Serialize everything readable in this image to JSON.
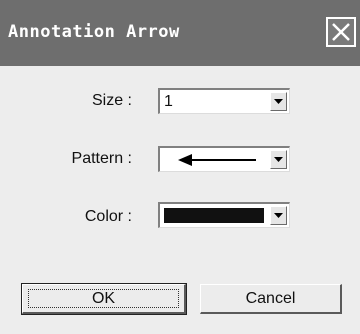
{
  "dialog": {
    "title": "Annotation Arrow",
    "close_icon": "close-icon"
  },
  "fields": {
    "size": {
      "label": "Size :",
      "value": "1"
    },
    "pattern": {
      "label": "Pattern :",
      "value_icon": "arrow-left-icon"
    },
    "color": {
      "label": "Color :",
      "swatch_color": "#111111"
    }
  },
  "buttons": {
    "ok_label": "OK",
    "cancel_label": "Cancel"
  }
}
